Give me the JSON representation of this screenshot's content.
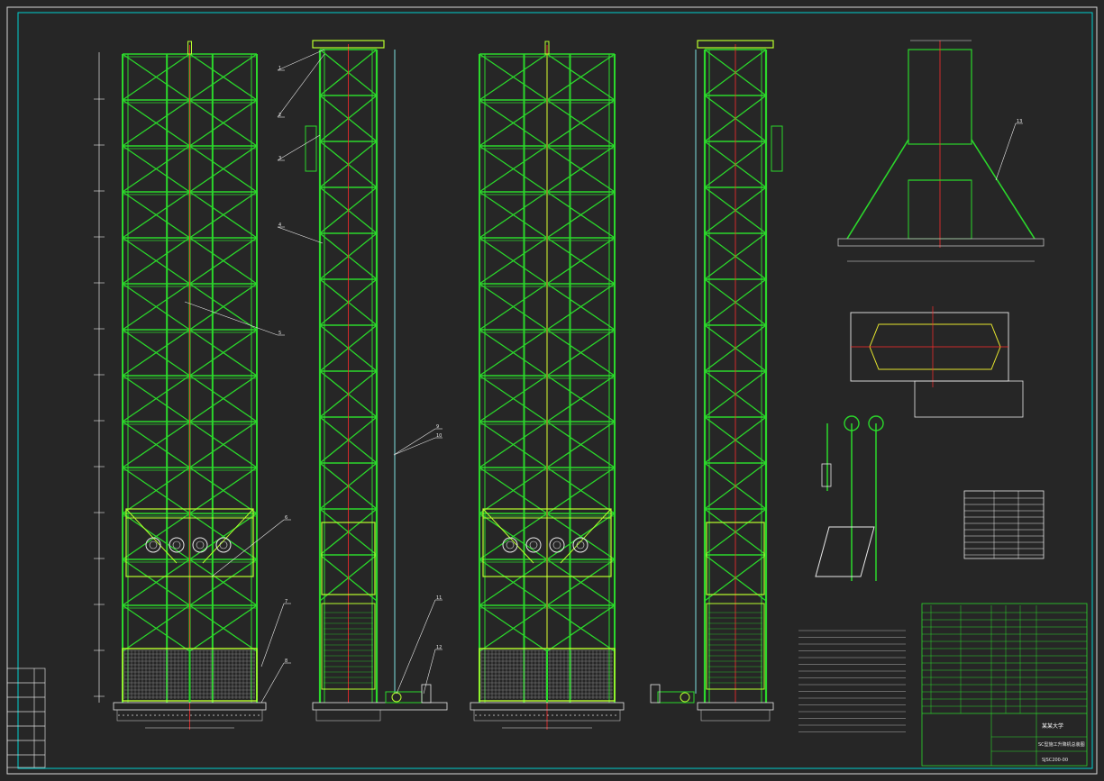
{
  "drawing": {
    "background": "#262626",
    "frame_color": "#00d0d0",
    "truss_color": "#2bd82b",
    "bright_color": "#b8ff2e",
    "center_color": "#ff2b2b",
    "dim_color": "#e6e6e6",
    "accent_yellow": "#e6e62e"
  },
  "callouts": [
    "1",
    "2",
    "3",
    "4",
    "5",
    "6",
    "7",
    "8",
    "9",
    "10",
    "11",
    "12",
    "13"
  ],
  "title_block": {
    "company": "某某大学",
    "drawing_title": "SC型施工升降机总装图",
    "drawing_number": "SJSC200-00"
  }
}
